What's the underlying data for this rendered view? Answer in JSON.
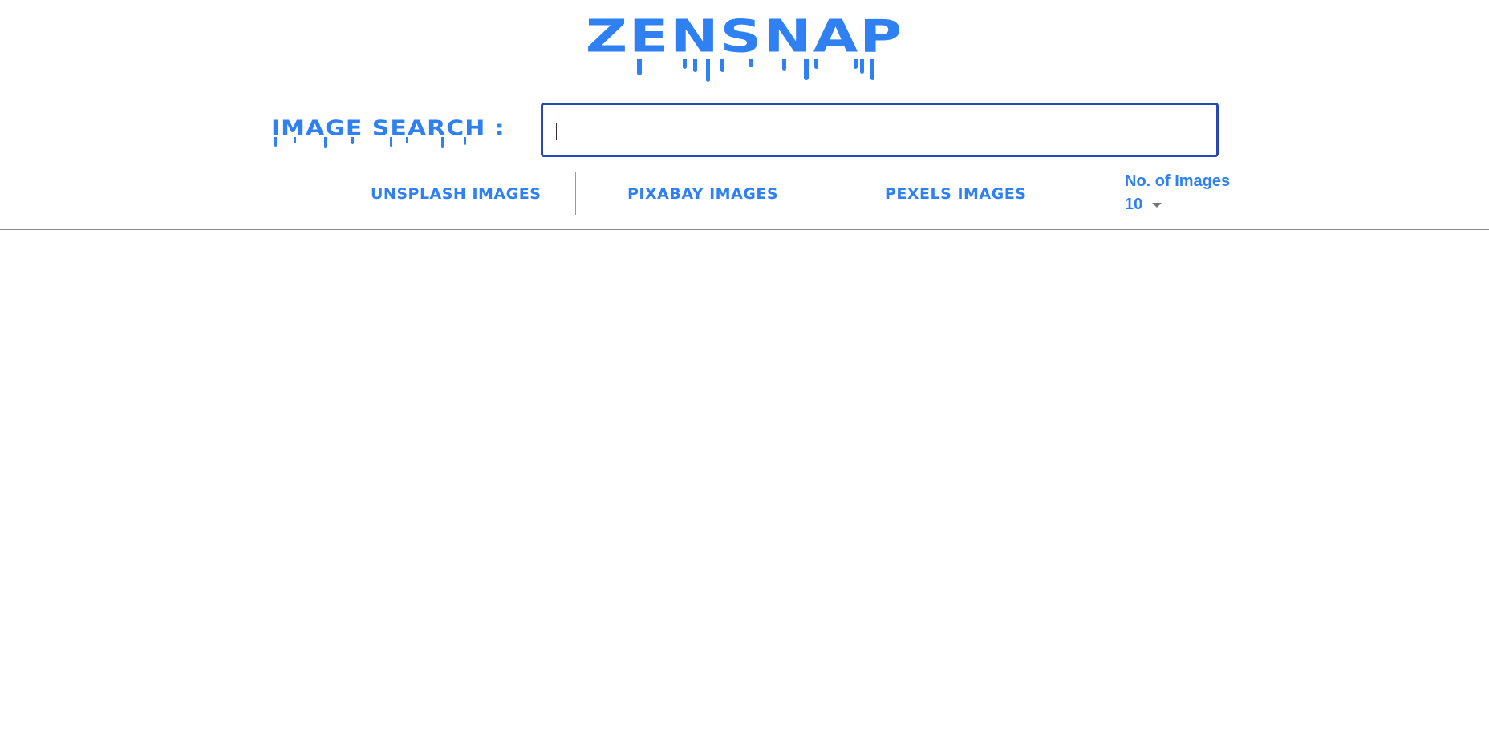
{
  "header": {
    "logo": "ZENSNAP",
    "search_label": "IMAGE SEARCH :",
    "search_value": "",
    "search_placeholder": ""
  },
  "tabs": [
    {
      "label": "UNSPLASH IMAGES"
    },
    {
      "label": "PIXABAY IMAGES"
    },
    {
      "label": "PEXELS IMAGES"
    }
  ],
  "image_count": {
    "label": "No. of Images",
    "selected": "10"
  },
  "colors": {
    "accent": "#2f80f3",
    "search_border": "#2b47b6",
    "divider": "#7f9bd8"
  }
}
